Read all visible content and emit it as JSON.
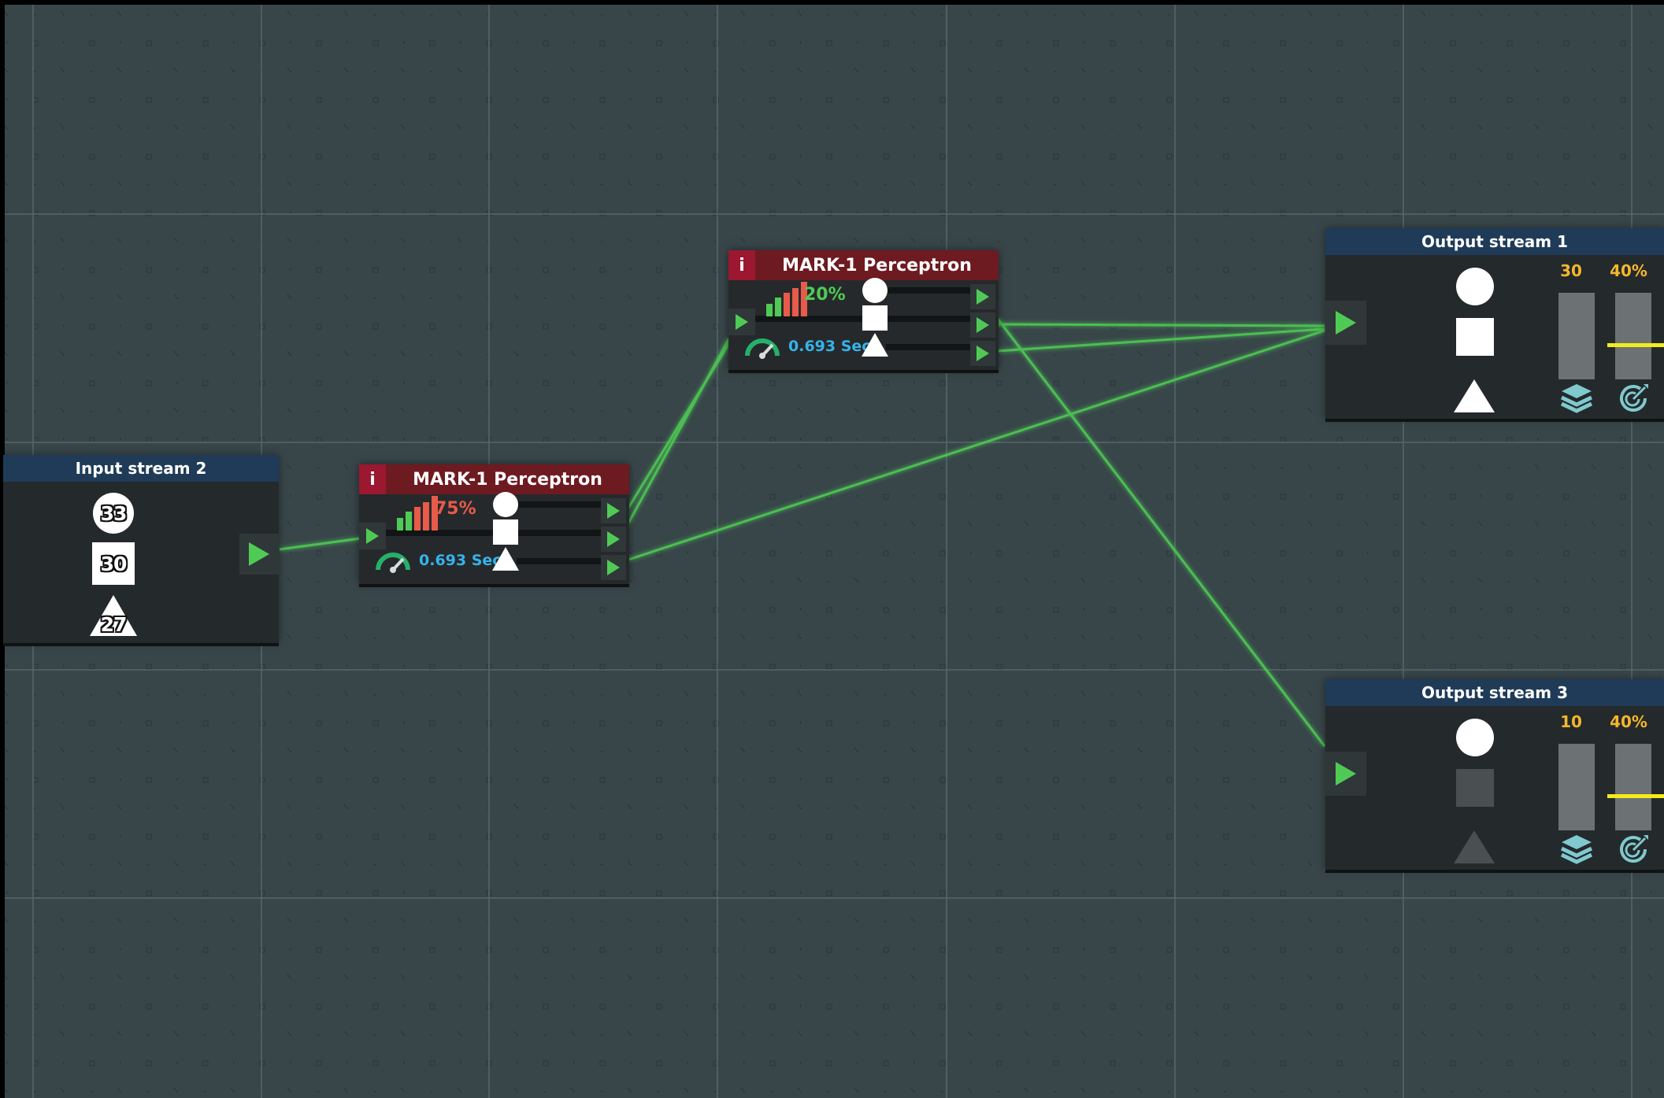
{
  "colors": {
    "board_bg": "#38464a",
    "grid_major": "#56676a",
    "wire": "#4fcb55",
    "port_arrow": "#4fcb55",
    "stream_header": "#1f3b57",
    "node_header": "#6e1a21",
    "info_badge": "#9c1730",
    "accuracy_high": "#e85a4a",
    "accuracy_low": "#4fcb55",
    "speed_text": "#35b3ea",
    "stat_text": "#f4b72c",
    "threshold_marker": "#f2ec1c"
  },
  "input_stream_2": {
    "title": "Input stream 2",
    "circle_count": "33",
    "square_count": "30",
    "triangle_count": "27"
  },
  "perceptron_a": {
    "info_label": "i",
    "title": "MARK-1 Perceptron",
    "accuracy": "75%",
    "speed": "0.693 Sec",
    "accuracy_icon": "bar-chart-icon",
    "speed_icon": "speedometer-icon"
  },
  "perceptron_b": {
    "info_label": "i",
    "title": "MARK-1 Perceptron",
    "accuracy": "20%",
    "speed": "0.693 Sec",
    "accuracy_icon": "bar-chart-icon",
    "speed_icon": "speedometer-icon"
  },
  "output_stream_1": {
    "title": "Output stream 1",
    "count": "30",
    "target": "40%",
    "threshold_level": 0.4,
    "shapes_enabled": [
      "circle",
      "square",
      "triangle"
    ],
    "count_icon": "layers-icon",
    "target_icon": "target-icon"
  },
  "output_stream_3": {
    "title": "Output stream 3",
    "count": "10",
    "target": "40%",
    "threshold_level": 0.4,
    "shapes_enabled": [
      "circle"
    ],
    "count_icon": "layers-icon",
    "target_icon": "target-icon"
  }
}
